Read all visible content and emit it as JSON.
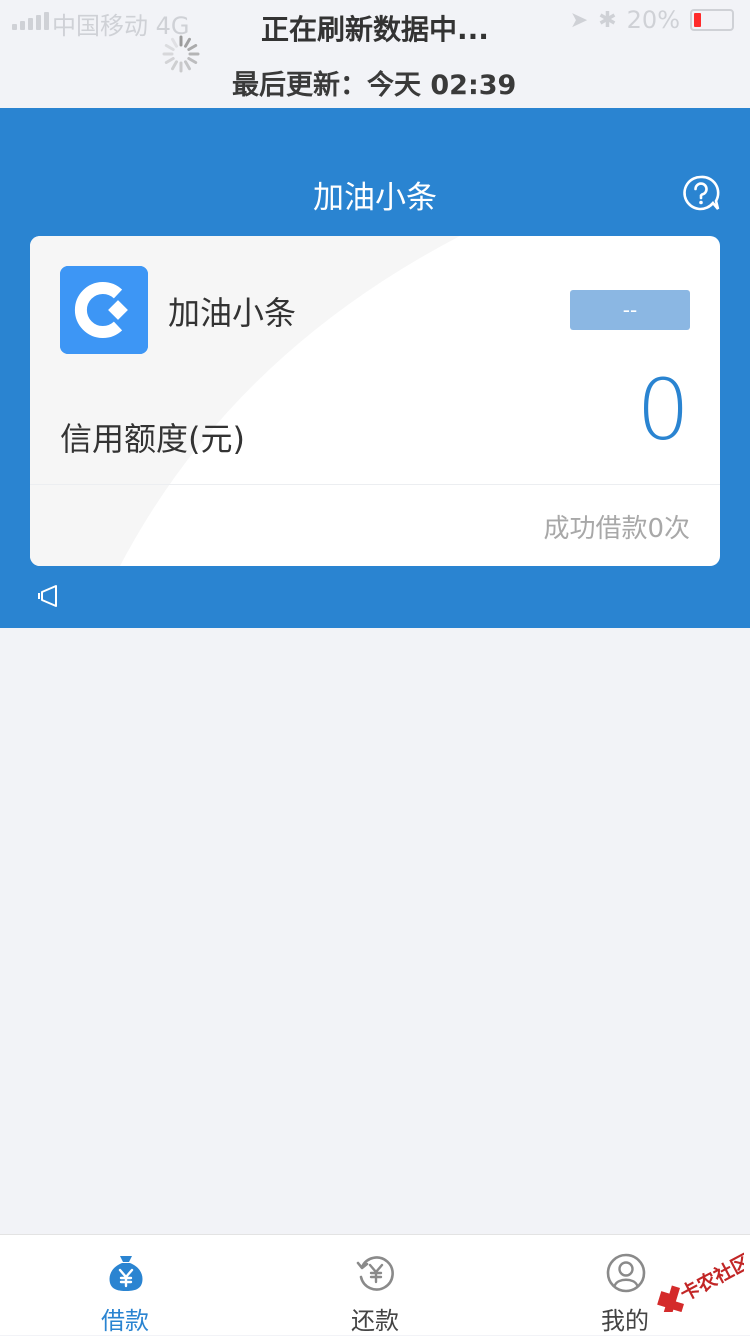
{
  "status_bar": {
    "carrier": "中国移动  4G",
    "battery": "20%",
    "battery_level": 0.2
  },
  "refresh": {
    "title": "正在刷新数据中...",
    "last_update": "最后更新：今天 02:39"
  },
  "header": {
    "title": "加油小条"
  },
  "card": {
    "name": "加油小条",
    "status_chip": "--",
    "credit_label": "信用额度(元)",
    "credit_value": "0",
    "borrow_count": "成功借款0次"
  },
  "tabs": [
    {
      "label": "借款",
      "icon": "money-bag-icon",
      "active": true
    },
    {
      "label": "还款",
      "icon": "repay-icon",
      "active": false
    },
    {
      "label": "我的",
      "icon": "user-icon",
      "active": false
    }
  ],
  "watermark": "卡农社区",
  "colors": {
    "primary": "#2a84d1",
    "logo": "#3d96f5",
    "background": "#f2f3f7"
  }
}
